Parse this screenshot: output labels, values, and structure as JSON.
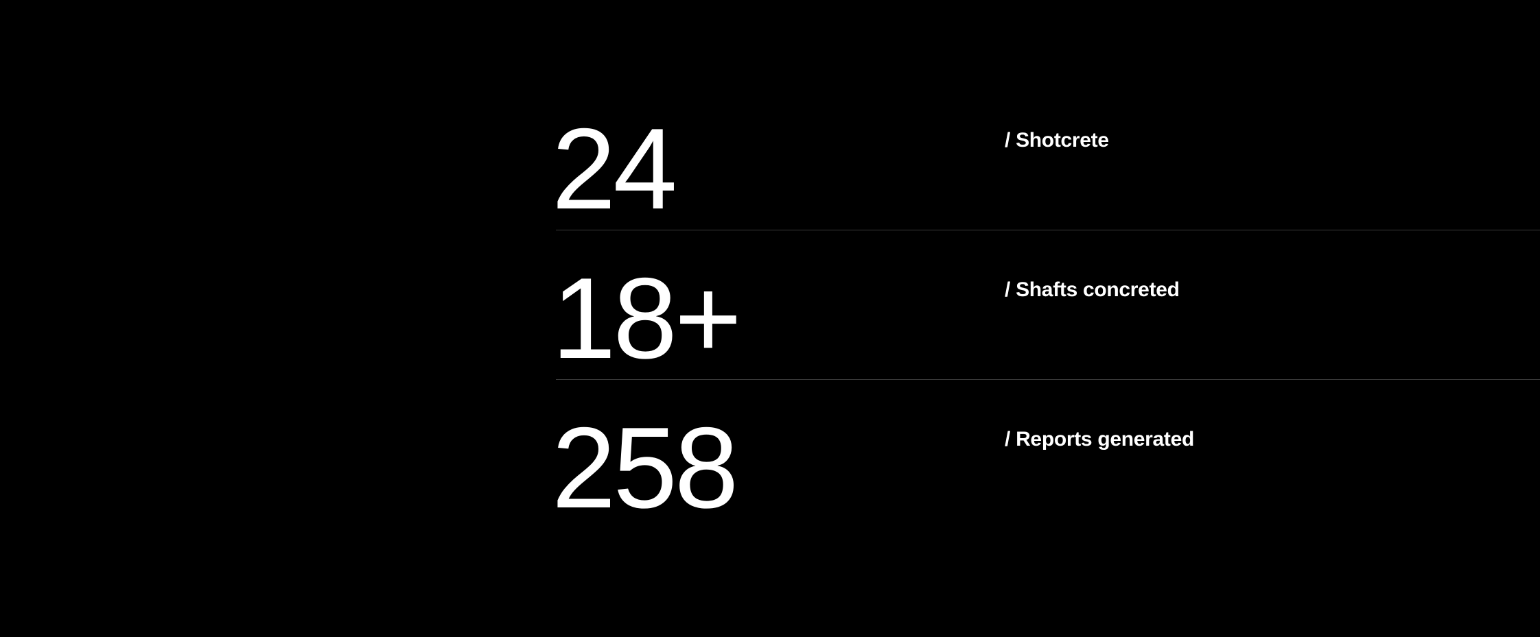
{
  "colors": {
    "background": "#000000",
    "text": "#ffffff",
    "divider": "#3a3a3a"
  },
  "stats": [
    {
      "value": "24",
      "label": "/ Shotcrete"
    },
    {
      "value": "18+",
      "label": "/ Shafts concreted"
    },
    {
      "value": "258",
      "label": "/ Reports generated"
    }
  ]
}
